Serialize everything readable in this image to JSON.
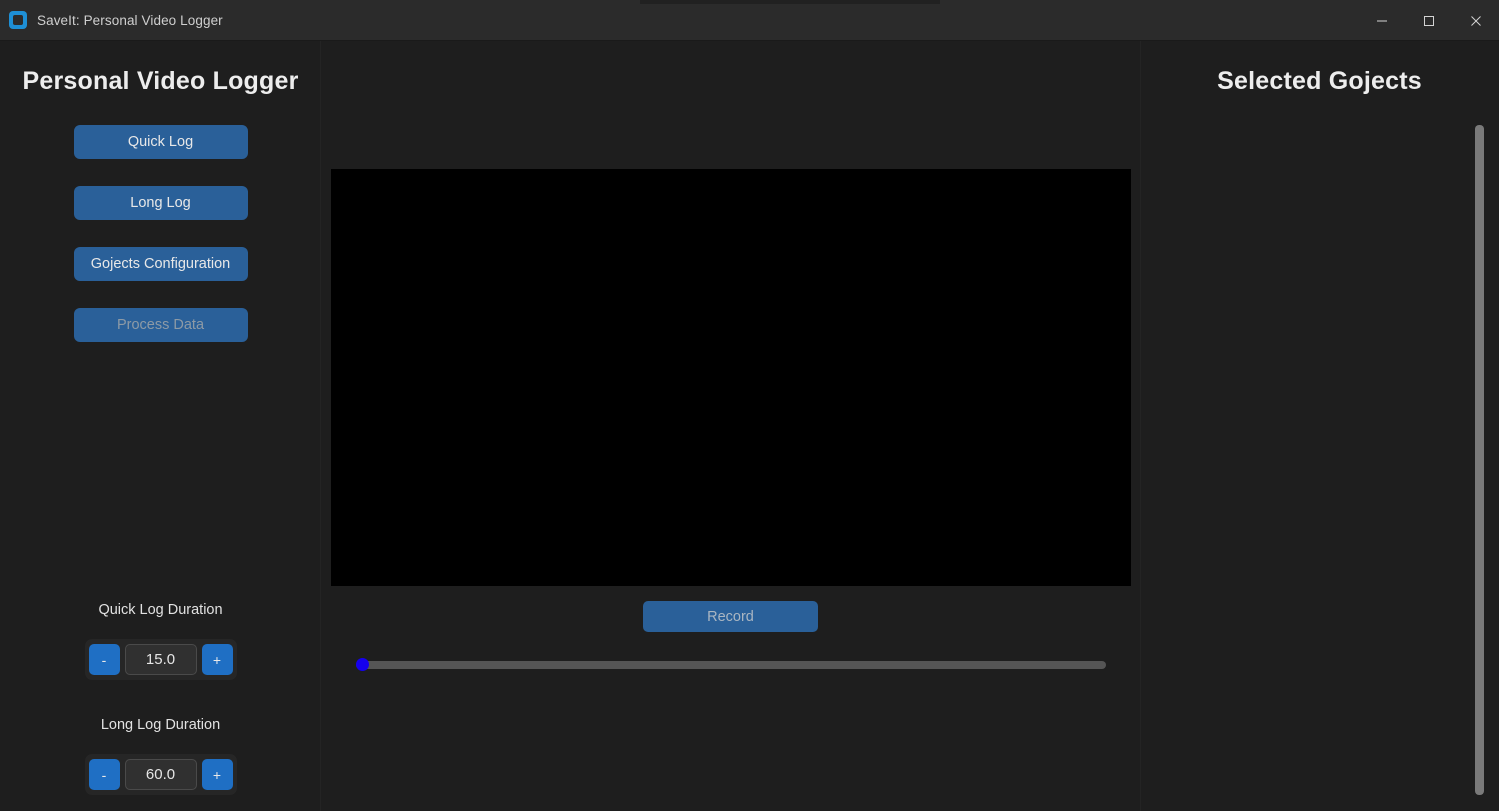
{
  "window": {
    "title": "SaveIt: Personal Video Logger",
    "app_icon": "app-logo-icon",
    "controls": {
      "minimize_label": "Minimize",
      "maximize_label": "Maximize",
      "close_label": "Close"
    }
  },
  "sidebar": {
    "title": "Personal Video Logger",
    "buttons": [
      {
        "label": "Quick Log",
        "enabled": true
      },
      {
        "label": "Long Log",
        "enabled": true
      },
      {
        "label": "Gojects Configuration",
        "enabled": true
      },
      {
        "label": "Process Data",
        "enabled": false
      }
    ],
    "durations": [
      {
        "label": "Quick Log Duration",
        "value": "15.0",
        "decrement_label": "-",
        "increment_label": "+"
      },
      {
        "label": "Long Log Duration",
        "value": "60.0",
        "decrement_label": "-",
        "increment_label": "+"
      }
    ]
  },
  "center": {
    "video_preview": "",
    "record_label": "Record",
    "seek": {
      "value": 0,
      "min": 0,
      "max": 100
    }
  },
  "right_panel": {
    "title": "Selected Gojects",
    "items": []
  },
  "colors": {
    "window_chrome": "#2b2b2b",
    "panel_bg": "#1e1e1e",
    "accent_button": "#2a6099",
    "stepper_button": "#1f6fc4",
    "slider_thumb": "#1500ee",
    "slider_track": "#555555",
    "scrollbar_thumb": "#7a7a7a",
    "text_primary": "#ededed",
    "text_disabled": "#8d9aa6",
    "video_bg": "#000000"
  }
}
